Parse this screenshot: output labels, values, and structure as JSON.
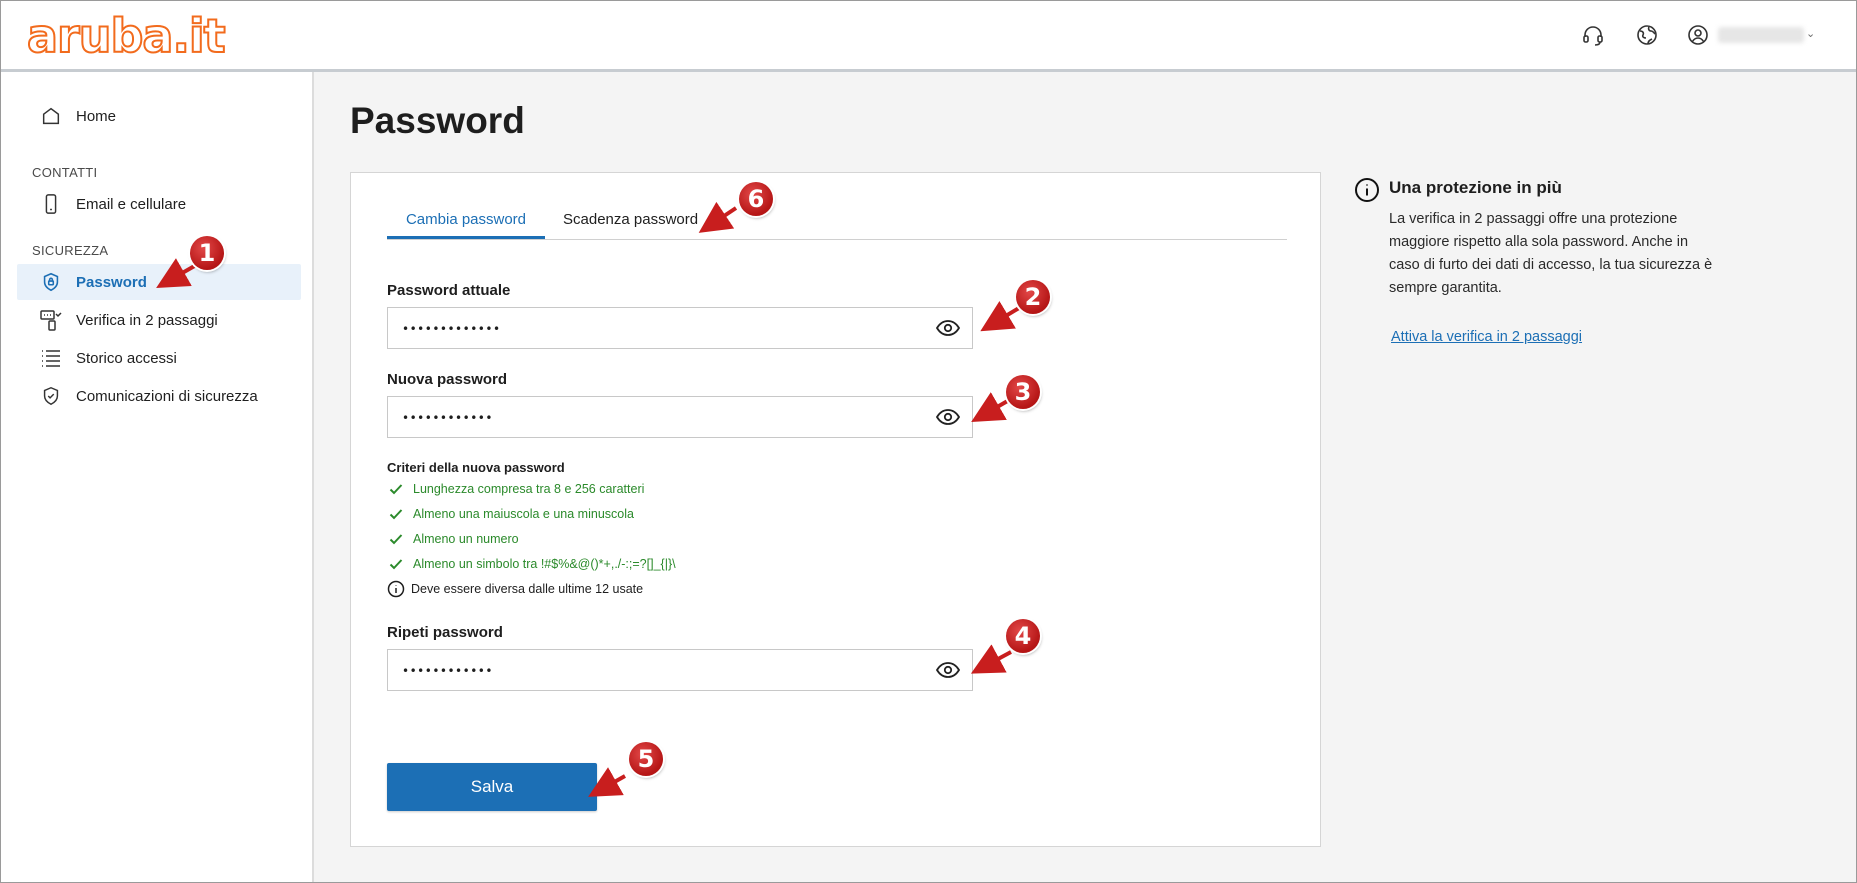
{
  "header": {
    "logo_text": "aruba.it",
    "icons": [
      "headset-icon",
      "help-globe-icon",
      "user-circle-icon",
      "chevron-down-icon"
    ],
    "user_chevron": "⌄"
  },
  "sidebar": {
    "home": "Home",
    "section_contacts": "CONTATTI",
    "email_phone": "Email e cellulare",
    "section_security": "SICUREZZA",
    "items": [
      {
        "label": "Password",
        "icon": "shield-lock-icon",
        "active": true
      },
      {
        "label": "Verifica in 2 passaggi",
        "icon": "two-step-icon",
        "active": false
      },
      {
        "label": "Storico accessi",
        "icon": "list-icon",
        "active": false
      },
      {
        "label": "Comunicazioni di sicurezza",
        "icon": "shield-check-icon",
        "active": false
      }
    ]
  },
  "main": {
    "title": "Password",
    "tabs": [
      {
        "label": "Cambia password",
        "active": true
      },
      {
        "label": "Scadenza password",
        "active": false
      }
    ],
    "current_password": {
      "label": "Password attuale",
      "value": "•••••••••••••"
    },
    "new_password": {
      "label": "Nuova password",
      "value": "••••••••••••"
    },
    "criteria": {
      "title": "Criteri della nuova password",
      "items": [
        "Lunghezza compresa tra 8 e 256 caratteri",
        "Almeno una maiuscola e una minuscola",
        "Almeno un numero",
        "Almeno un simbolo tra !#$%&@()*+,./-:;=?[]_{|}\\"
      ],
      "info": "Deve essere diversa dalle ultime 12 usate"
    },
    "repeat_password": {
      "label": "Ripeti password",
      "value": "••••••••••••"
    },
    "save_label": "Salva"
  },
  "info_panel": {
    "title": "Una protezione in più",
    "text": "La verifica in 2 passaggi offre una protezione maggiore rispetto alla sola password. Anche in caso di furto dei dati di accesso, la tua sicurezza è sempre garantita.",
    "link": "Attiva la verifica in 2 passaggi"
  },
  "annotations": [
    "1",
    "2",
    "3",
    "4",
    "5",
    "6"
  ],
  "colors": {
    "brand_orange": "#f26b1d",
    "accent_blue": "#1c6fb5",
    "success_green": "#2b8a2b",
    "annotation_red": "#c81e1e"
  }
}
